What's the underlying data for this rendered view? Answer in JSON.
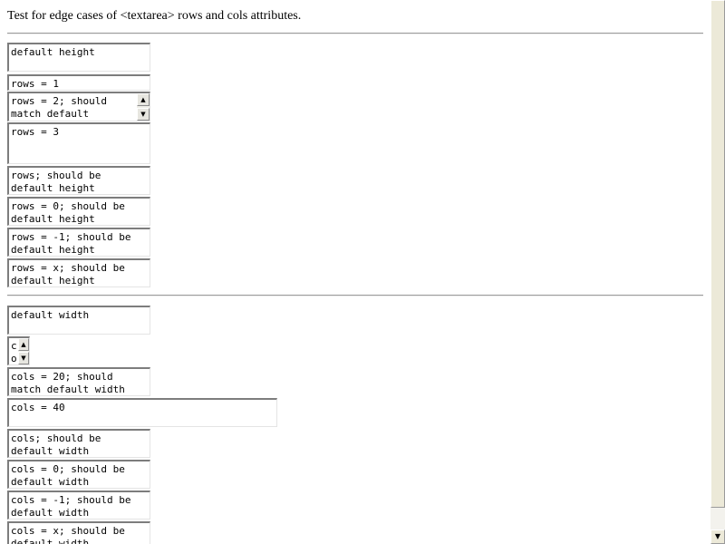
{
  "page": {
    "heading": "Test for edge cases of <textarea> rows and cols attributes."
  },
  "rows_section": {
    "textareas": [
      {
        "text": "default height"
      },
      {
        "text": "rows = 1"
      },
      {
        "text": "rows = 2; should match default"
      },
      {
        "text": "rows = 3"
      },
      {
        "text": "rows; should be default height"
      },
      {
        "text": "rows = 0; should be default height"
      },
      {
        "text": "rows = -1; should be default height"
      },
      {
        "text": "rows = x; should be default height"
      }
    ]
  },
  "cols_section": {
    "textareas": [
      {
        "text": "default width"
      },
      {
        "text": "co"
      },
      {
        "text": "cols = 20; should match default width"
      },
      {
        "text": "cols = 40"
      },
      {
        "text": "cols; should be default width"
      },
      {
        "text": "cols = 0; should be default width"
      },
      {
        "text": "cols = -1; should be default width"
      },
      {
        "text": "cols = x; should be default width"
      }
    ]
  },
  "icons": {
    "scroll_up": "▲",
    "scroll_down": "▼"
  },
  "colors": {
    "background": "#ffffff",
    "textarea_border_dark": "#7d7d7d",
    "scrollbar": "#ece9d8"
  }
}
